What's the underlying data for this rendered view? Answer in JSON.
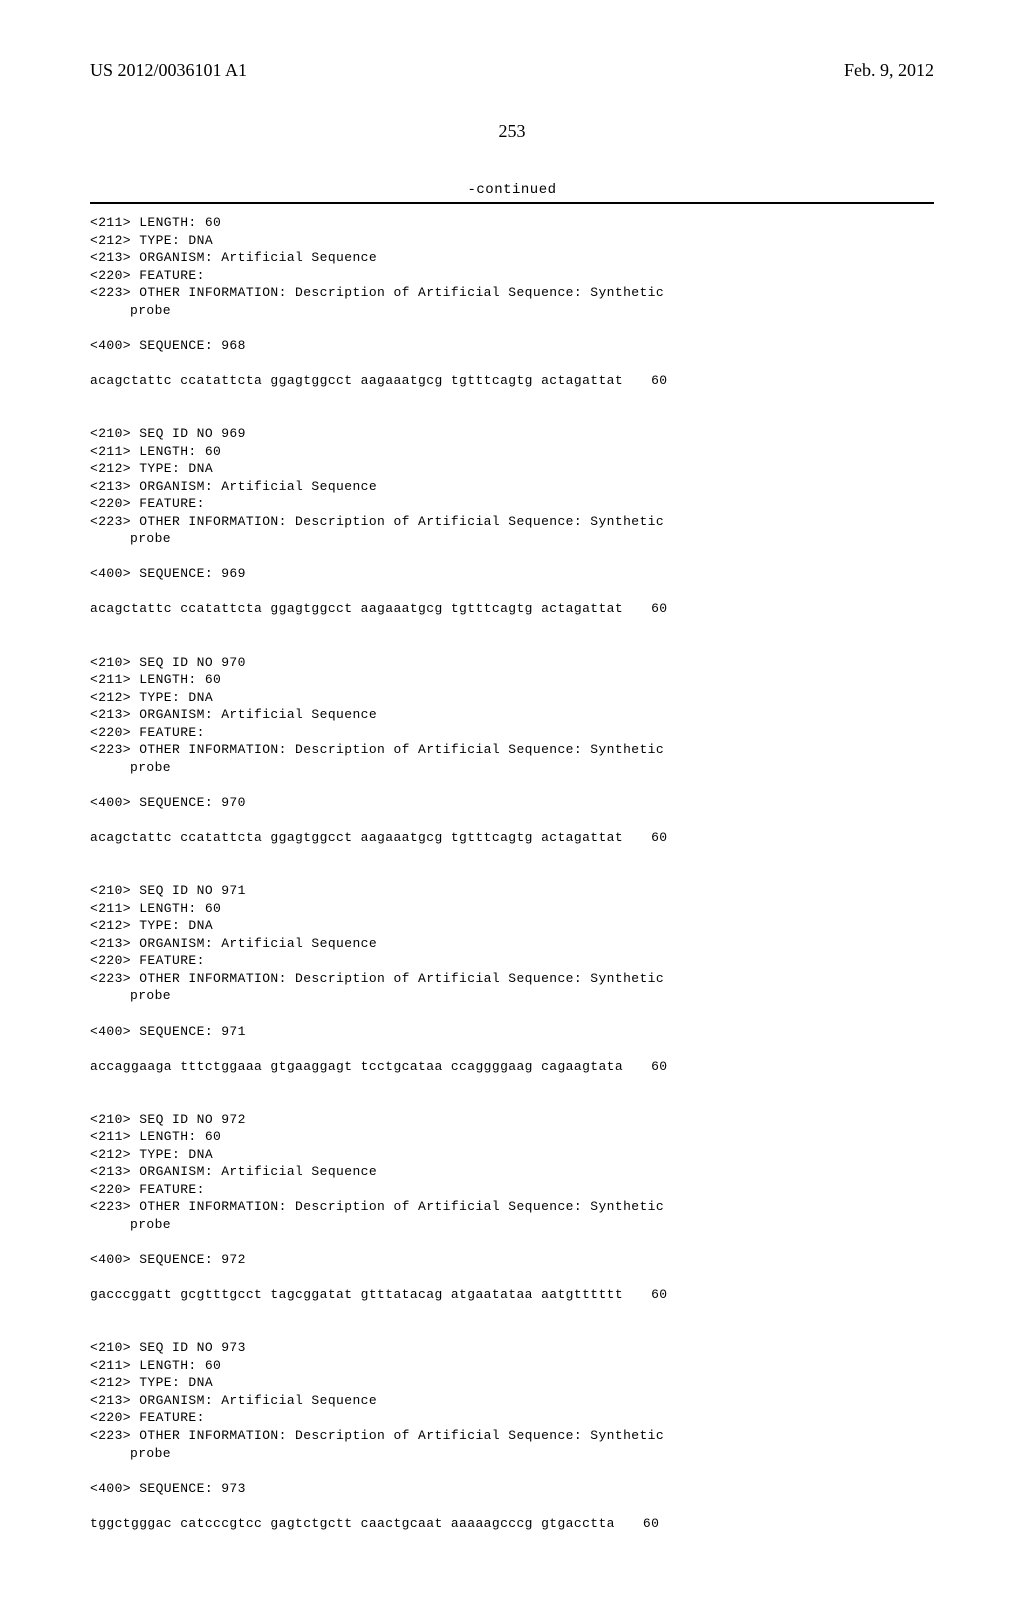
{
  "header": {
    "left": "US 2012/0036101 A1",
    "right": "Feb. 9, 2012"
  },
  "page_number": "253",
  "continued": "-continued",
  "labels": {
    "seq_id": "SEQ ID NO",
    "length": "LENGTH:",
    "type": "TYPE:",
    "organism": "ORGANISM:",
    "feature": "FEATURE:",
    "other_info": "OTHER INFORMATION:",
    "sequence": "SEQUENCE:",
    "probe": "probe"
  },
  "tags": {
    "t210": "<210>",
    "t211": "<211>",
    "t212": "<212>",
    "t213": "<213>",
    "t220": "<220>",
    "t223": "<223>",
    "t400": "<400>"
  },
  "common": {
    "length_val": "60",
    "type_val": "DNA",
    "organism_val": "Artificial Sequence",
    "other_info_text": "Description of Artificial Sequence: Synthetic",
    "pos_60": "60"
  },
  "entries": [
    {
      "id": "968",
      "header_includes_210": false,
      "seq_groups": "acagctattc ccatattcta ggagtggcct aagaaatgcg tgtttcagtg actagattat"
    },
    {
      "id": "969",
      "header_includes_210": true,
      "seq_groups": "acagctattc ccatattcta ggagtggcct aagaaatgcg tgtttcagtg actagattat"
    },
    {
      "id": "970",
      "header_includes_210": true,
      "seq_groups": "acagctattc ccatattcta ggagtggcct aagaaatgcg tgtttcagtg actagattat"
    },
    {
      "id": "971",
      "header_includes_210": true,
      "seq_groups": "accaggaaga tttctggaaa gtgaaggagt tcctgcataa ccaggggaag cagaagtata"
    },
    {
      "id": "972",
      "header_includes_210": true,
      "seq_groups": "gacccggatt gcgtttgcct tagcggatat gtttatacag atgaatataa aatgtttttt"
    },
    {
      "id": "973",
      "header_includes_210": true,
      "seq_groups": "tggctgggac catcccgtcc gagtctgctt caactgcaat aaaaagcccg gtgacctta"
    }
  ]
}
